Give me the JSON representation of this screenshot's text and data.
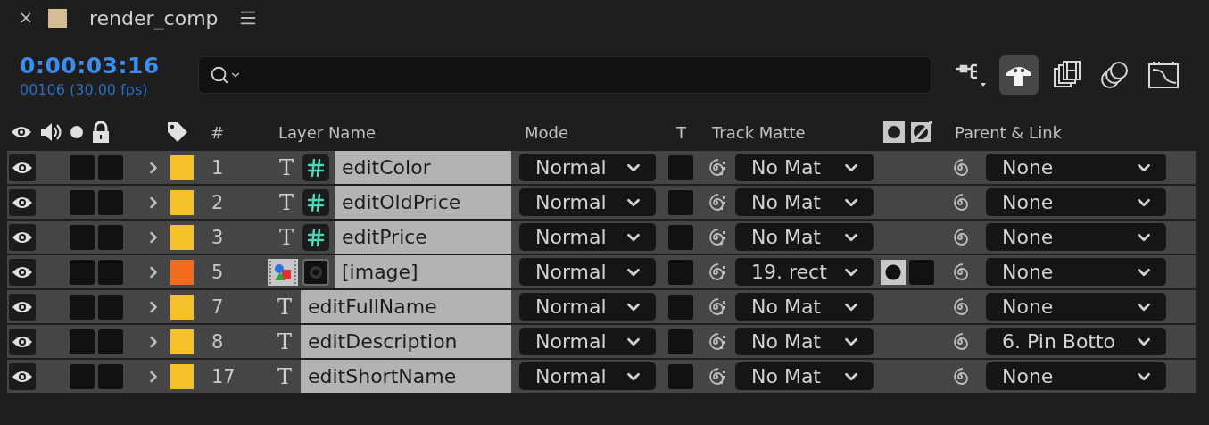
{
  "panel": {
    "title": "render_comp"
  },
  "timecode": "0:00:03:16",
  "frame_info": "00106 (30.00 fps)",
  "toolbar": [
    {
      "kind": "flowchart",
      "selected": false
    },
    {
      "kind": "shy",
      "selected": true
    },
    {
      "kind": "frame_blend",
      "selected": false
    },
    {
      "kind": "motion_blur",
      "selected": false
    },
    {
      "kind": "graph",
      "selected": false
    }
  ],
  "columns": {
    "number": "#",
    "layer_name": "Layer Name",
    "mode": "Mode",
    "preserve": "T",
    "track_matte": "Track Matte",
    "parent": "Parent & Link"
  },
  "rows": [
    {
      "kind": "text_expression",
      "visible": true,
      "color": "#f5c02a",
      "number": "1",
      "glyph": "T",
      "name": "editColor",
      "mode": "Normal",
      "track_matte": "No Mat",
      "matte_switch": false,
      "parent": "None"
    },
    {
      "kind": "text_expression",
      "visible": true,
      "color": "#f5c02a",
      "number": "2",
      "glyph": "T",
      "name": "editOldPrice",
      "mode": "Normal",
      "track_matte": "No Mat",
      "matte_switch": false,
      "parent": "None"
    },
    {
      "kind": "text_expression",
      "visible": true,
      "color": "#f5c02a",
      "number": "3",
      "glyph": "T",
      "name": "editPrice",
      "mode": "Normal",
      "track_matte": "No Mat",
      "matte_switch": false,
      "parent": "None"
    },
    {
      "kind": "image",
      "visible": true,
      "color": "#f26b1f",
      "number": "5",
      "name": "[image]",
      "mode": "Normal",
      "track_matte": "19. rect",
      "matte_switch": true,
      "parent": "None"
    },
    {
      "kind": "text",
      "visible": true,
      "color": "#f5c02a",
      "number": "7",
      "glyph": "T",
      "name": "editFullName",
      "mode": "Normal",
      "track_matte": "No Mat",
      "matte_switch": false,
      "parent": "None"
    },
    {
      "kind": "text",
      "visible": true,
      "color": "#f5c02a",
      "number": "8",
      "glyph": "T",
      "name": "editDescription",
      "mode": "Normal",
      "track_matte": "No Mat",
      "matte_switch": false,
      "parent": "6. Pin Botto"
    },
    {
      "kind": "text",
      "visible": true,
      "color": "#f5c02a",
      "number": "17",
      "glyph": "T",
      "name": "editShortName",
      "mode": "Normal",
      "track_matte": "No Mat",
      "matte_switch": false,
      "parent": "None"
    }
  ]
}
